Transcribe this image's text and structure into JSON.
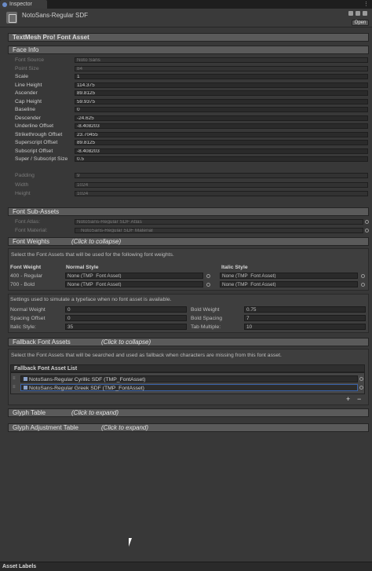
{
  "window": {
    "tab": "Inspector"
  },
  "asset": {
    "name": "NotoSans-Regular SDF",
    "open_label": "Open"
  },
  "sections": {
    "main": "TextMesh Pro! Font Asset",
    "face_info": "Face Info",
    "font_sub_assets": "Font Sub-Assets",
    "font_weights": "Font Weights",
    "font_weights_hint": "(Click to collapse)",
    "fallback": "Fallback Font Assets",
    "fallback_hint": "(Click to collapse)",
    "glyph_table": "Glyph Table",
    "glyph_table_hint": "(Click to expand)",
    "glyph_adjust": "Glyph Adjustment Table",
    "glyph_adjust_hint": "(Click to expand)"
  },
  "face_info": {
    "rows": [
      {
        "label": "Font Source",
        "value": "Noto Sans"
      },
      {
        "label": "Point Size",
        "value": "84"
      },
      {
        "label": "Scale",
        "value": "1"
      },
      {
        "label": "Line Height",
        "value": "114.375"
      },
      {
        "label": "Ascender",
        "value": "89.8125"
      },
      {
        "label": "Cap Height",
        "value": "59.9375"
      },
      {
        "label": "Baseline",
        "value": "0"
      },
      {
        "label": "Descender",
        "value": "-24.625"
      },
      {
        "label": "Underline Offset",
        "value": "-8.408203"
      },
      {
        "label": "Strikethrough Offset",
        "value": "23.70455"
      },
      {
        "label": "Superscript Offset",
        "value": "89.8125"
      },
      {
        "label": "Subscript Offset",
        "value": "-8.408203"
      },
      {
        "label": "Super / Subscript Size",
        "value": "0.5"
      }
    ],
    "atlas_rows": [
      {
        "label": "Padding",
        "value": "9"
      },
      {
        "label": "Width",
        "value": "1024"
      },
      {
        "label": "Height",
        "value": "1024"
      }
    ]
  },
  "sub_assets": {
    "font_atlas_label": "Font Atlas:",
    "font_atlas_value": "NotoSans-Regular SDF Atlas",
    "font_material_label": "Font Material:",
    "font_material_value": "NotoSans-Regular SDF Material"
  },
  "font_weights": {
    "description": "Select the Font Assets that will be used for the following font weights.",
    "col_weight": "Font Weight",
    "col_normal": "Normal Style",
    "col_italic": "Italic Style",
    "rows": [
      {
        "weight": "400 - Regular",
        "normal": "None (TMP_Font Asset)",
        "italic": "None (TMP_Font Asset)"
      },
      {
        "weight": "700 - Bold",
        "normal": "None (TMP_Font Asset)",
        "italic": "None (TMP_Font Asset)"
      }
    ],
    "simulate_text": "Settings used to simulate a typeface when no font asset is available.",
    "normal_weight_label": "Normal Weight",
    "normal_weight": "0",
    "bold_weight_label": "Bold Weight",
    "bold_weight": "0.75",
    "spacing_offset_label": "Spacing Offset",
    "spacing_offset": "0",
    "bold_spacing_label": "Bold Spacing",
    "bold_spacing": "7",
    "italic_style_label": "Italic Style:",
    "italic_style": "35",
    "tab_multiple_label": "Tab Multiple:",
    "tab_multiple": "10"
  },
  "fallback": {
    "description": "Select the Font Assets that will be searched and used as fallback when characters are missing from this font asset.",
    "list_header": "Fallback Font Asset List",
    "items": [
      "NotoSans-Regular Cyrillic SDF (TMP_FontAsset)",
      "NotoSans-Regular Greek SDF (TMP_FontAsset)"
    ],
    "add": "+",
    "remove": "−"
  },
  "footer": {
    "label": "Asset Labels"
  }
}
